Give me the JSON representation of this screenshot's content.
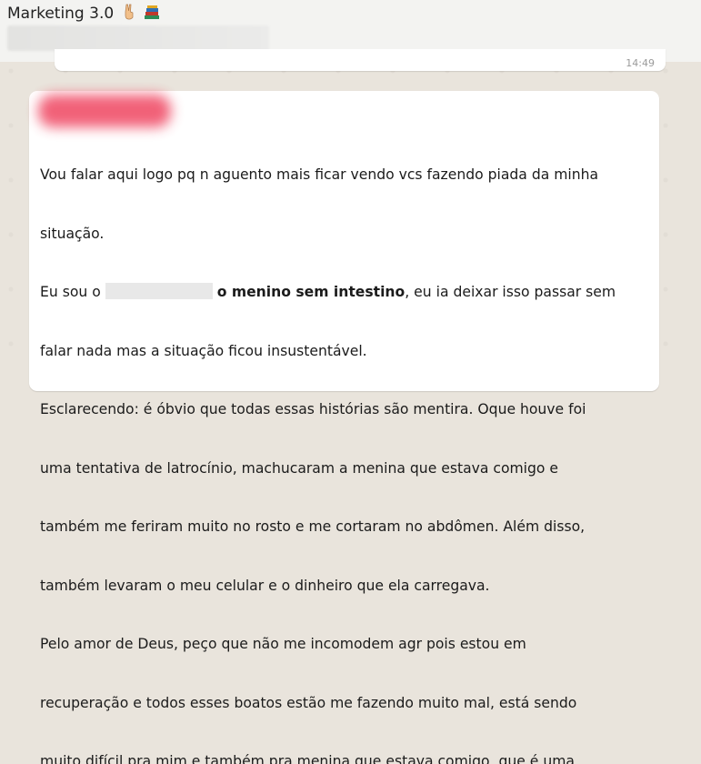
{
  "header": {
    "group_title": "Marketing 3.0",
    "emoji_icons": [
      "victory-hand-icon",
      "books-icon"
    ]
  },
  "previous_message": {
    "time": "14:49"
  },
  "message": {
    "lines": [
      "Vou falar aqui logo pq n aguento mais ficar vendo vcs fazendo piada da minha",
      "situação.",
      "Eu sou o",
      "o menino sem intestino",
      ", eu ia deixar isso passar sem",
      "falar nada mas a situação ficou insustentável.",
      "Esclarecendo: é óbvio que todas essas histórias são mentira. Oque houve foi",
      "uma tentativa de latrocínio, machucaram a menina que estava comigo e",
      "também me feriram muito no rosto e me cortaram no abdômen. Além disso,",
      "também levaram o meu celular e o dinheiro que ela carregava.",
      "Pelo amor de Deus, peço que não me incomodem agr pois estou em",
      "recuperação e todos esses boatos estão me fazendo muito mal, está sendo",
      "muito difícil pra mim e também pra menina que estava comigo, que é uma"
    ]
  }
}
